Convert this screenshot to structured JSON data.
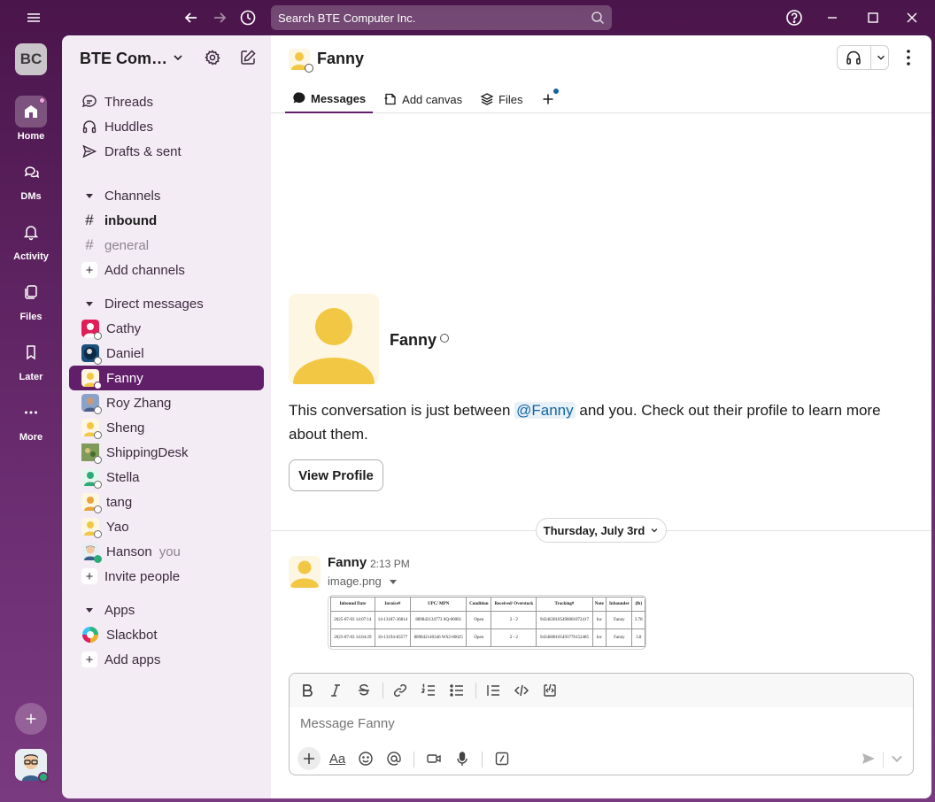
{
  "window": {
    "search_placeholder": "Search BTE Computer Inc."
  },
  "rail": {
    "workspace_initials": "BC",
    "items": [
      {
        "label": "Home",
        "icon": "home-icon"
      },
      {
        "label": "DMs",
        "icon": "dms-icon"
      },
      {
        "label": "Activity",
        "icon": "bell-icon"
      },
      {
        "label": "Files",
        "icon": "files-icon"
      },
      {
        "label": "Later",
        "icon": "bookmark-icon"
      },
      {
        "label": "More",
        "icon": "more-icon"
      }
    ]
  },
  "sidebar": {
    "workspace_name": "BTE Com…",
    "nav": [
      {
        "label": "Threads",
        "icon": "threads-icon"
      },
      {
        "label": "Huddles",
        "icon": "headphones-icon"
      },
      {
        "label": "Drafts & sent",
        "icon": "send-icon"
      }
    ],
    "channels_header": "Channels",
    "channels": [
      {
        "label": "inbound",
        "style": "bold"
      },
      {
        "label": "general",
        "style": "muted"
      }
    ],
    "add_channels": "Add channels",
    "dms_header": "Direct messages",
    "dms": [
      {
        "label": "Cathy"
      },
      {
        "label": "Daniel"
      },
      {
        "label": "Fanny",
        "selected": true
      },
      {
        "label": "Roy Zhang"
      },
      {
        "label": "Sheng"
      },
      {
        "label": "ShippingDesk"
      },
      {
        "label": "Stella"
      },
      {
        "label": "tang"
      },
      {
        "label": "Yao"
      },
      {
        "label": "Hanson",
        "suffix": "you"
      }
    ],
    "invite_people": "Invite people",
    "apps_header": "Apps",
    "apps": [
      {
        "label": "Slackbot"
      }
    ],
    "add_apps": "Add apps"
  },
  "channel": {
    "title": "Fanny",
    "tabs": [
      {
        "label": "Messages",
        "active": true
      },
      {
        "label": "Add canvas"
      },
      {
        "label": "Files"
      }
    ],
    "intro_name": "Fanny",
    "intro_text_before": "This conversation is just between ",
    "intro_mention": "@Fanny",
    "intro_text_after": " and you. Check out their profile to learn more about them.",
    "view_profile": "View Profile",
    "date_divider": "Thursday, July 3rd"
  },
  "message": {
    "author": "Fanny",
    "time": "2:13 PM",
    "file_name": "image.png",
    "attachment_table": {
      "headers": [
        "Inbound Date",
        "Invoice#",
        "UPC/ MPN",
        "Condition",
        "Received/ Overstock",
        "Tracking#",
        "Note",
        "Inbounder",
        "(lb)"
      ],
      "rows": [
        [
          "2025-07-03 14:07:14",
          "14-13187-36814",
          "889842134773 SQ-00001",
          "Open",
          "2 - 2",
          "9434630105496001072417",
          "hw",
          "Fanny",
          "3.78"
        ],
        [
          "2025-07-03 14:04:29",
          "10-13194-83577",
          "889842140346 WS2-00025",
          "Open",
          "2 - 2",
          "9434608105493776152485",
          "hw",
          "Fanny",
          "3.8"
        ]
      ]
    }
  },
  "composer": {
    "placeholder": "Message Fanny",
    "aa_label": "Aa"
  },
  "colors": {
    "aubergine": "#4a154b",
    "selected": "#611f69",
    "sidebar_bg": "#f4ecf5",
    "mention": "#1264a3"
  }
}
